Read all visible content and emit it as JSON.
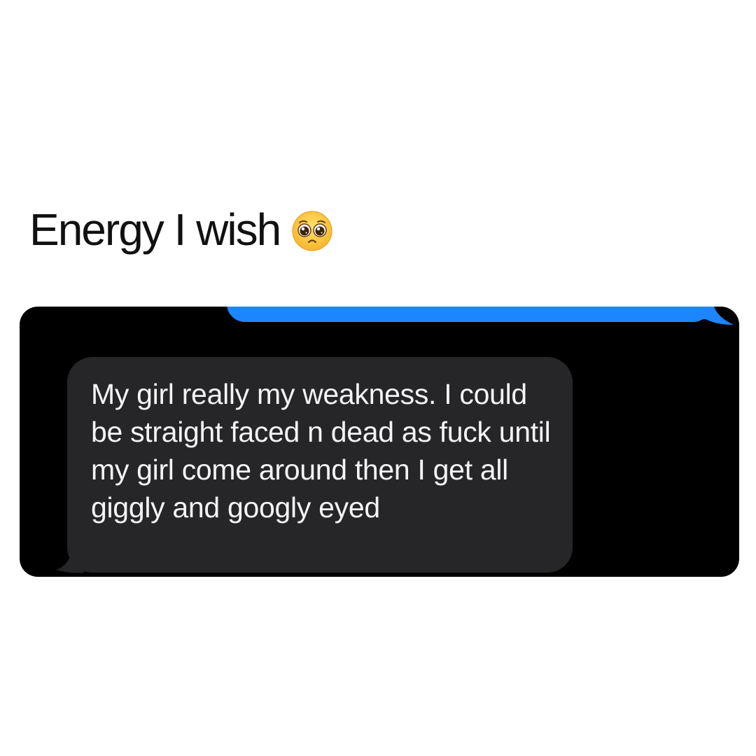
{
  "caption": {
    "text": "Energy I wish",
    "emoji_icon": "pleading-face-emoji"
  },
  "chat": {
    "sent_bubble_color": "#1c86ff",
    "received_bubble_color": "#262628",
    "background_color": "#000000",
    "received_message": "My girl really my weakness. I could be straight faced n dead as fuck until my girl come around then I get all giggly and googly eyed"
  }
}
